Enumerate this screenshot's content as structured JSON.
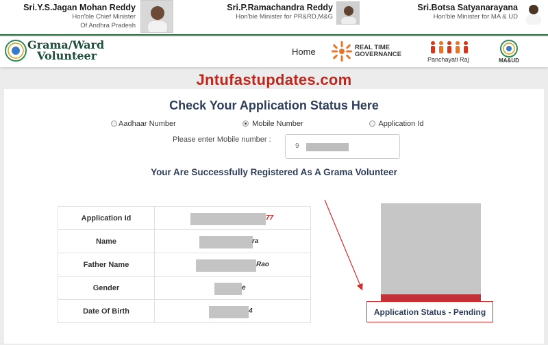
{
  "ministers": [
    {
      "name": "Sri.Y.S.Jagan Mohan Reddy",
      "role_line1": "Hon'ble Chief Minister",
      "role_line2": "Of Andhra Pradesh"
    },
    {
      "name": "Sri.P.Ramachandra Reddy",
      "role_line1": "Hon'ble Minister for PR&RD,M&G",
      "role_line2": ""
    },
    {
      "name": "Sri.Botsa Satyanarayana",
      "role_line1": "Hon'ble Minister for MA & UD",
      "role_line2": ""
    }
  ],
  "nav": {
    "brand_line1": "Grama/Ward",
    "brand_line2": "Volunteer",
    "home": "Home",
    "rtg_line1": "REAL TIME",
    "rtg_line2": "GOVERNANCE",
    "pr_label": "Panchayati Raj",
    "maud_label": "MA&UD"
  },
  "watermark": "Jntufastupdates.com",
  "form": {
    "title": "Check Your Application Status Here",
    "options": [
      "Aadhaar Number",
      "Mobile Number",
      "Application Id"
    ],
    "selected": "Mobile Number",
    "prompt": "Please enter Mobile number :",
    "input_prefix": "9"
  },
  "success_message": "Your Are Successfully Registered As A Grama Volunteer",
  "details": [
    {
      "label": "Application Id",
      "visible_suffix": "77"
    },
    {
      "label": "Name",
      "visible_suffix": "ra"
    },
    {
      "label": "Father Name",
      "visible_suffix": "Rao"
    },
    {
      "label": "Gender",
      "visible_suffix": "e"
    },
    {
      "label": "Date Of Birth",
      "visible_suffix": "4"
    }
  ],
  "status_text": "Application Status - Pending",
  "colors": {
    "accent_navy": "#2e3e5b",
    "brand_red": "#c0271c",
    "brand_green": "#1f4f3a"
  }
}
